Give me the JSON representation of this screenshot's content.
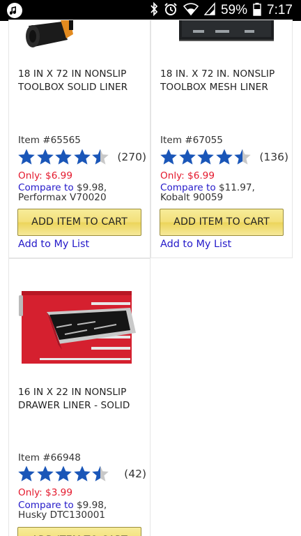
{
  "status_bar": {
    "battery_percent": "59%",
    "time": "7:17"
  },
  "products": [
    {
      "title": "18 IN X 72 IN NONSLIP TOOLBOX SOLID LINER",
      "item_number": "Item #65565",
      "rating": 4.5,
      "review_count": "(270)",
      "price": "Only: $6.99",
      "compare_label": "Compare to",
      "compare_price": "$9.98,",
      "compare_product": "Performax V70020",
      "cart_label": "ADD ITEM TO CART",
      "list_label": "Add to My List"
    },
    {
      "title": "18 IN. X 72 IN. NONSLIP TOOLBOX MESH LINER",
      "item_number": "Item #67055",
      "rating": 4.5,
      "review_count": "(136)",
      "price": "Only: $6.99",
      "compare_label": "Compare to",
      "compare_price": "$11.97,",
      "compare_product": "Kobalt 90059",
      "cart_label": "ADD ITEM TO CART",
      "list_label": "Add to My List"
    },
    {
      "title": "16 IN X 22 IN NONSLIP DRAWER LINER - SOLID",
      "item_number": "Item #66948",
      "rating": 4.5,
      "review_count": "(42)",
      "price": "Only: $3.99",
      "compare_label": "Compare to",
      "compare_price": "$9.98,",
      "compare_product": "Husky DTC130001",
      "cart_label": "ADD ITEM TO CART"
    }
  ],
  "colors": {
    "price": "#e4182c",
    "link": "#2318c9",
    "star": "#1a56b8",
    "star_empty": "#c8c8c8",
    "button": "#f3e07a"
  }
}
